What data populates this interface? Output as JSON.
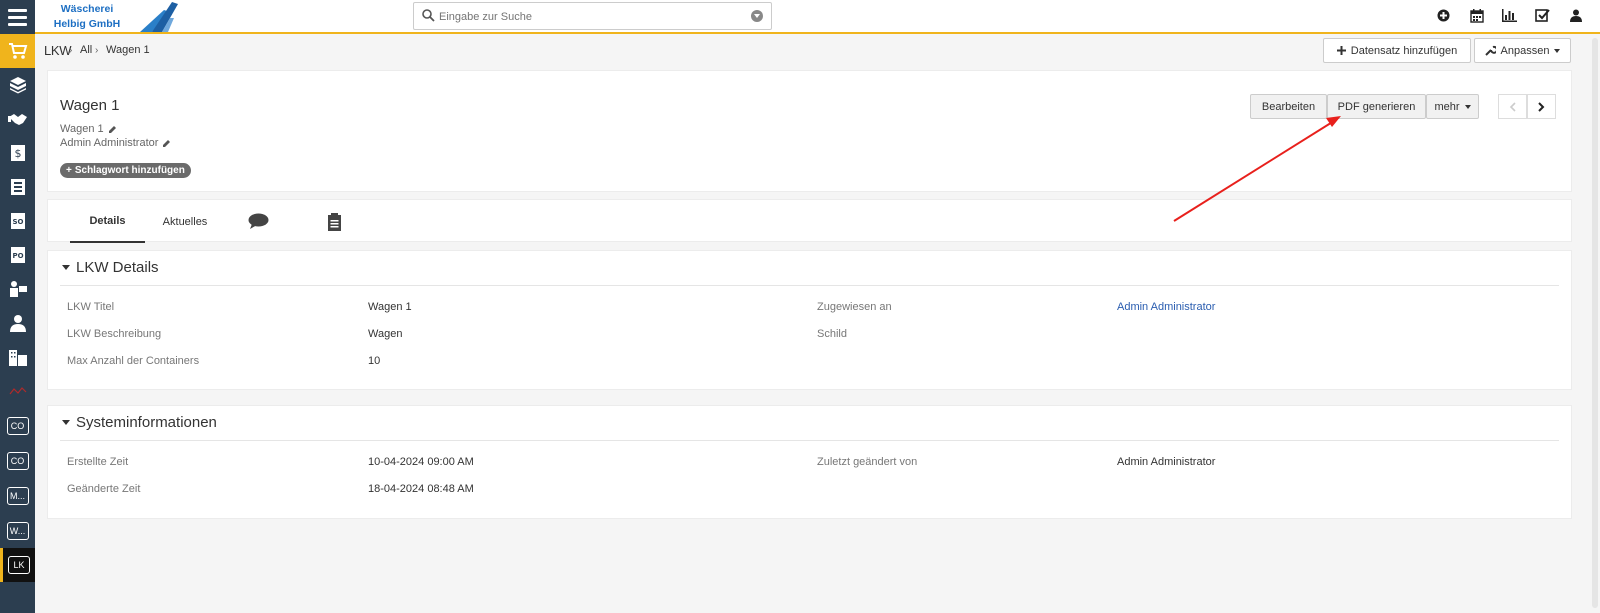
{
  "header": {
    "company_name": "Wäscherei Helbig GmbH",
    "search_placeholder": "Eingabe zur Suche",
    "icons": [
      "plus-circle-icon",
      "calendar-icon",
      "bar-chart-icon",
      "checkbox-icon",
      "user-icon"
    ]
  },
  "sidebar": {
    "items": [
      {
        "icon": "cart-icon",
        "active": true
      },
      {
        "icon": "boxes-icon"
      },
      {
        "icon": "handshake-icon"
      },
      {
        "icon": "invoice-icon"
      },
      {
        "icon": "contacts-icon"
      },
      {
        "icon": "id-card-icon"
      },
      {
        "icon": "po-icon"
      },
      {
        "icon": "person-desk-icon"
      },
      {
        "icon": "person-icon"
      },
      {
        "icon": "buildings-icon"
      },
      {
        "icon": "red-logo-icon"
      },
      {
        "label": "CO"
      },
      {
        "label": "CO"
      },
      {
        "label": "M..."
      },
      {
        "label": "W..."
      },
      {
        "label": "LK",
        "active": true
      }
    ]
  },
  "breadcrumb": {
    "module": "LKW",
    "all": "All",
    "record": "Wagen 1"
  },
  "actions": {
    "add_record": "Datensatz hinzufügen",
    "customize": "Anpassen"
  },
  "record": {
    "title": "Wagen 1",
    "subtitle": "Wagen 1",
    "owner": "Admin Administrator",
    "add_tag": "Schlagwort hinzufügen",
    "edit": "Bearbeiten",
    "generate_pdf": "PDF generieren",
    "more": "mehr"
  },
  "tabs": [
    {
      "label": "Details",
      "active": true
    },
    {
      "label": "Aktuelles"
    },
    {
      "icon": "comment-icon"
    },
    {
      "icon": "document-icon"
    }
  ],
  "sections": {
    "lkw_details": {
      "title": "LKW Details",
      "fields": {
        "title_label": "LKW Titel",
        "title_value": "Wagen 1",
        "assigned_label": "Zugewiesen an",
        "assigned_value": "Admin Administrator",
        "desc_label": "LKW Beschreibung",
        "desc_value": "Wagen",
        "sign_label": "Schild",
        "max_label": "Max Anzahl der Containers",
        "max_value": "10"
      }
    },
    "system_info": {
      "title": "Systeminformationen",
      "fields": {
        "created_label": "Erstellte Zeit",
        "created_value": "10-04-2024 09:00 AM",
        "modified_by_label": "Zuletzt geändert von",
        "modified_by_value": "Admin Administrator",
        "modified_label": "Geänderte Zeit",
        "modified_value": "18-04-2024 08:48 AM"
      }
    }
  },
  "colors": {
    "accent": "#f0b41c",
    "sidebar": "#2c3e50",
    "link": "#2a5db0",
    "annotation_arrow": "#e8201c"
  }
}
